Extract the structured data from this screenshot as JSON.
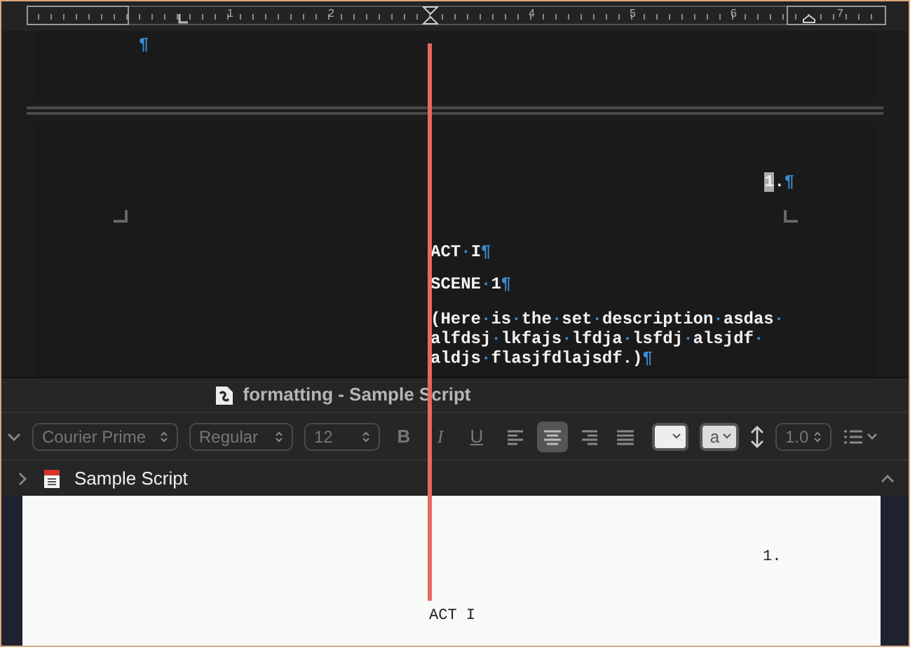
{
  "ruler": {
    "numbers": [
      "1",
      "2",
      "4",
      "5",
      "6",
      "7"
    ]
  },
  "editor": {
    "page_number": {
      "digit": "1",
      "rest": ".¶"
    },
    "top_pilcrow": "¶",
    "paragraphs": [
      "ACT·I¶",
      "SCENE·1¶",
      "(Here·is·the·set·description·asdas·alfdsj·lkfajs·lfdja·lsfdj·alsjdf·aldjs·flasjfdlajsdf.)¶"
    ]
  },
  "window": {
    "title": "formatting - Sample Script"
  },
  "toolbar": {
    "font": "Courier Prime",
    "style": "Regular",
    "size": "12",
    "format_buttons": [
      "B",
      "I",
      "U"
    ],
    "alignments": [
      {
        "kind": "left",
        "selected": false
      },
      {
        "kind": "center",
        "selected": true
      },
      {
        "kind": "right",
        "selected": false
      },
      {
        "kind": "justify",
        "selected": false
      }
    ],
    "text_color_label": "a",
    "line_spacing": "1.0"
  },
  "document": {
    "title": "Sample Script"
  },
  "preview": {
    "page_number": "1.",
    "lines": [
      "ACT I"
    ]
  }
}
